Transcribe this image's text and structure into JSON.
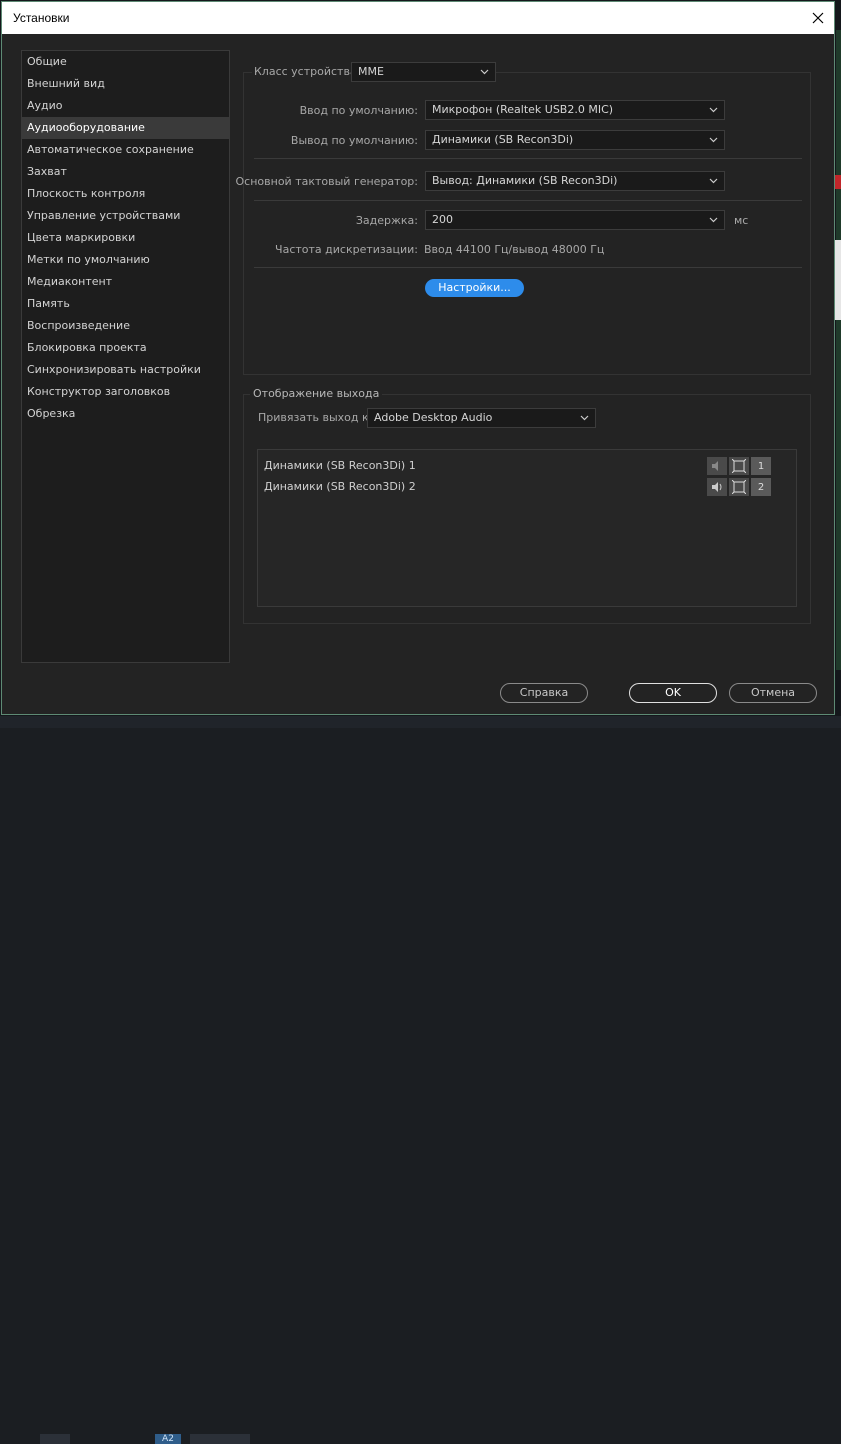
{
  "window": {
    "title": "Установки"
  },
  "sidebar": {
    "selected_index": 3,
    "items": [
      {
        "label": "Общие"
      },
      {
        "label": "Внешний вид"
      },
      {
        "label": "Аудио"
      },
      {
        "label": "Аудиооборудование"
      },
      {
        "label": "Автоматическое сохранение"
      },
      {
        "label": "Захват"
      },
      {
        "label": "Плоскость контроля"
      },
      {
        "label": "Управление устройствами"
      },
      {
        "label": "Цвета маркировки"
      },
      {
        "label": "Метки по умолчанию"
      },
      {
        "label": "Медиаконтент"
      },
      {
        "label": "Память"
      },
      {
        "label": "Воспроизведение"
      },
      {
        "label": "Блокировка проекта"
      },
      {
        "label": "Синхронизировать настройки"
      },
      {
        "label": "Конструктор заголовков"
      },
      {
        "label": "Обрезка"
      }
    ]
  },
  "device": {
    "class_label": "Класс устройства:",
    "class_value": "MME",
    "input_label": "Ввод по умолчанию:",
    "input_value": "Микрофон (Realtek USB2.0 MIC)",
    "output_label": "Вывод по умолчанию:",
    "output_value": "Динамики (SB Recon3Di)",
    "clock_label": "Основной тактовый генератор:",
    "clock_value": "Вывод: Динамики (SB Recon3Di)",
    "latency_label": "Задержка:",
    "latency_value": "200",
    "latency_unit": "мс",
    "rate_label": "Частота дискретизации:",
    "rate_value": "Ввод 44100 Гц/вывод 48000 Гц",
    "settings_button": "Настройки..."
  },
  "output_mapping": {
    "title": "Отображение выхода",
    "map_label": "Привязать выход к:",
    "map_value": "Adobe Desktop Audio",
    "channels": [
      {
        "label": "Динамики (SB Recon3Di) 1",
        "number": "1"
      },
      {
        "label": "Динамики (SB Recon3Di) 2",
        "number": "2"
      }
    ]
  },
  "footer": {
    "help": "Справка",
    "ok": "OK",
    "cancel": "Отмена"
  },
  "taskbar": {
    "active_label": "A2"
  },
  "colors": {
    "accent": "#2d8ceb",
    "dialog_bg": "#232323",
    "border": "#5e8a74"
  }
}
